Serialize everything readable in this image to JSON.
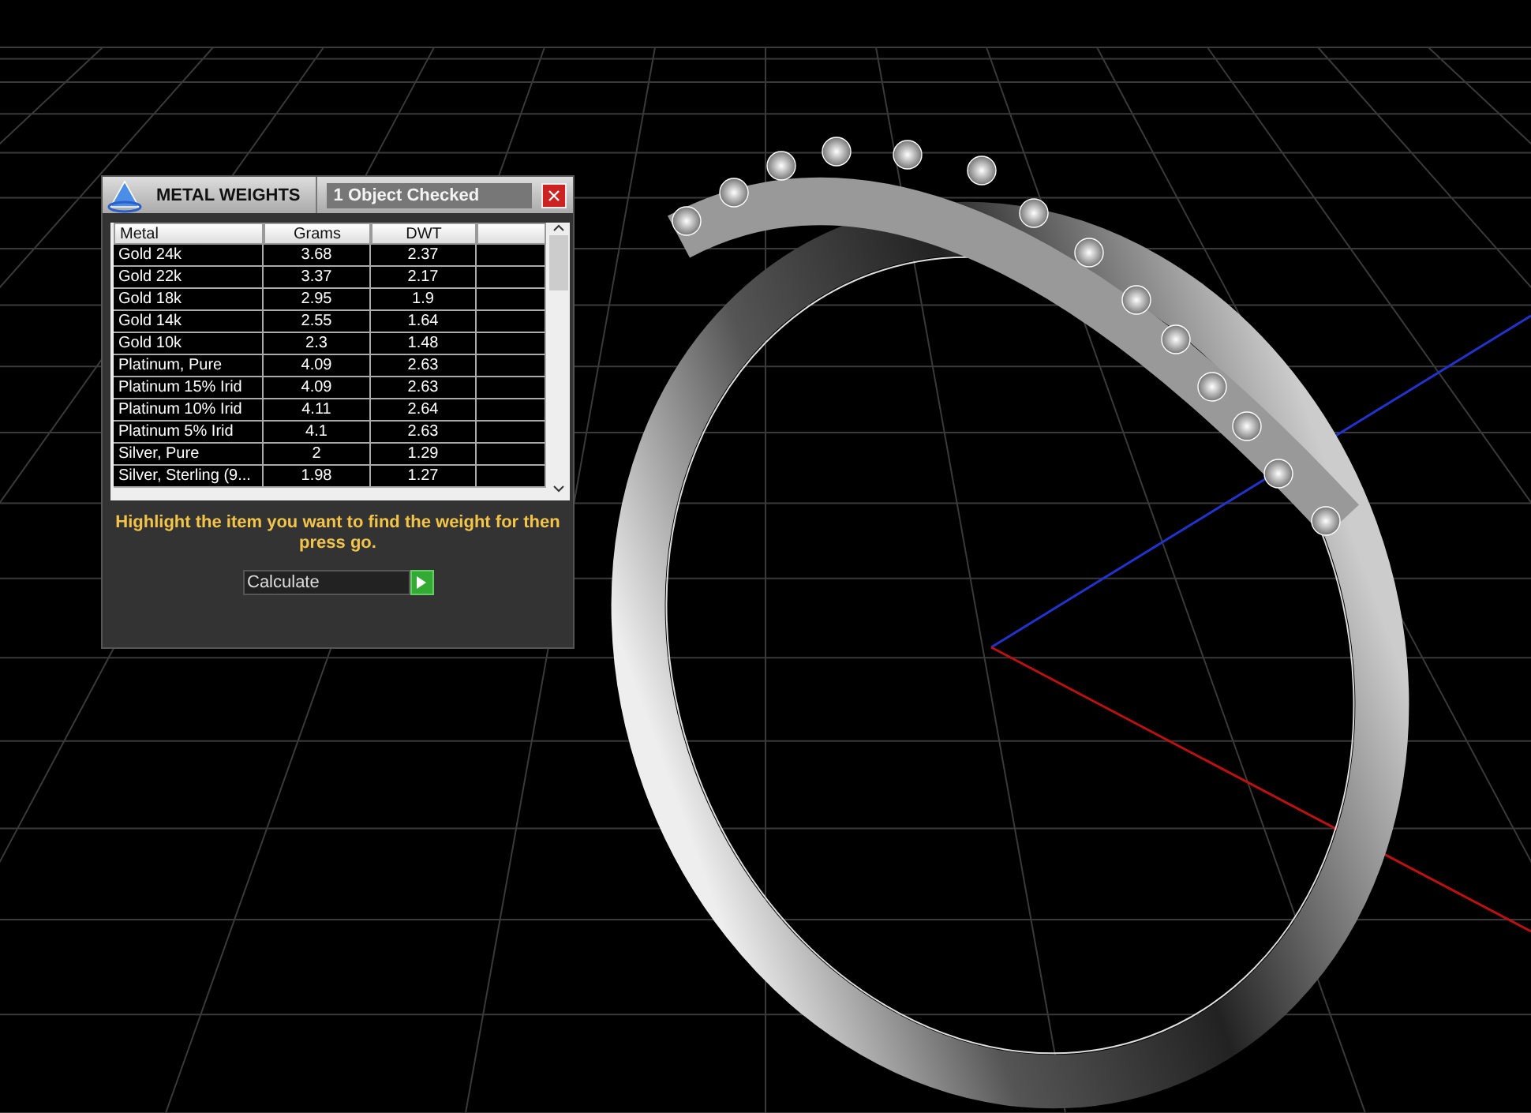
{
  "panel": {
    "title": "METAL WEIGHTS",
    "status": "1 Object Checked",
    "table": {
      "columns": [
        "Metal",
        "Grams",
        "DWT"
      ],
      "rows": [
        {
          "metal": "Gold 24k",
          "grams": "3.68",
          "dwt": "2.37"
        },
        {
          "metal": "Gold 22k",
          "grams": "3.37",
          "dwt": "2.17"
        },
        {
          "metal": "Gold 18k",
          "grams": "2.95",
          "dwt": "1.9"
        },
        {
          "metal": "Gold 14k",
          "grams": "2.55",
          "dwt": "1.64"
        },
        {
          "metal": "Gold 10k",
          "grams": "2.3",
          "dwt": "1.48"
        },
        {
          "metal": "Platinum, Pure",
          "grams": "4.09",
          "dwt": "2.63"
        },
        {
          "metal": "Platinum 15% Irid",
          "grams": "4.09",
          "dwt": "2.63"
        },
        {
          "metal": "Platinum 10% Irid",
          "grams": "4.11",
          "dwt": "2.64"
        },
        {
          "metal": "Platinum 5% Irid",
          "grams": "4.1",
          "dwt": "2.63"
        },
        {
          "metal": "Silver, Pure",
          "grams": "2",
          "dwt": "1.29"
        },
        {
          "metal": "Silver, Sterling (9...",
          "grams": "1.98",
          "dwt": "1.27"
        }
      ]
    },
    "instruction": "Highlight the item you want to find the weight for then press go.",
    "action": {
      "value": "Calculate"
    }
  }
}
